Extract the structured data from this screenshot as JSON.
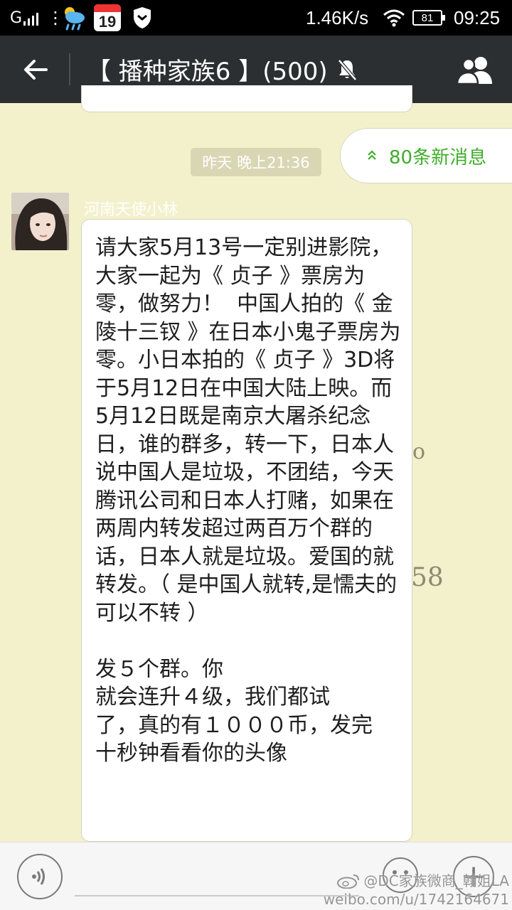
{
  "status_bar": {
    "network_type": "G",
    "net_speed": "1.46K/s",
    "calendar_day": "19",
    "battery": "81",
    "time": "09:25"
  },
  "title_bar": {
    "title": "【 播种家族6 】(500)"
  },
  "new_messages": {
    "label": "80条新消息"
  },
  "chat": {
    "timestamp": "昨天 晚上21:36",
    "message": {
      "sender": "河南天使小林",
      "text": "请大家5月13号一定别进影院，大家一起为《 贞子 》票房为零，做努力！  中国人拍的《 金陵十三钗 》在日本小鬼子票房为零。小日本拍的《 贞子 》3D将于5月12日在中国大陆上映。而5月12日既是南京大屠杀纪念日，谁的群多，转一下，日本人说中国人是垃圾，不团结，今天腾讯公司和日本人打赌，如果在两周内转发超过两百万个群的话，日本人就是垃圾。爱国的就转发。（ 是中国人就转,是懦夫的可以不转 ）\n\n发５个群。你\n就会连升４级，我们都试\n了，真的有１０００币，发完\n十秒钟看看你的头像"
    },
    "background_fragments": [
      "o",
      "58"
    ]
  },
  "input_bar": {
    "plus_label": "+"
  },
  "watermark": {
    "line1": "@DC家族微商_翰姐LA",
    "line2": "weibo.com/u/1742164671"
  },
  "colors": {
    "chat_background": "#f3f1cc",
    "title_bar": "#2b2f31",
    "accent_green": "#3fae29",
    "timestamp_chip": "#d9d6b4"
  }
}
